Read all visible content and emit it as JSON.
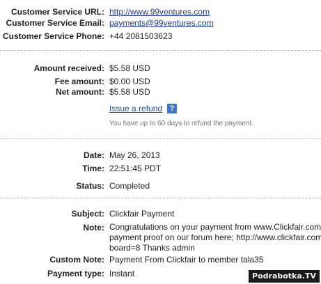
{
  "contact": {
    "url_label": "Customer Service URL:",
    "url_value": "http://www.99ventures.com",
    "email_label": "Customer Service Email:",
    "email_value": "payments@99ventures.com",
    "phone_label": "Customer Service Phone:",
    "phone_value": "+44 2081503623"
  },
  "amounts": {
    "received_label": "Amount received:",
    "received_value": "$5.58 USD",
    "fee_label": "Fee amount:",
    "fee_value": "$0.00 USD",
    "net_label": "Net amount:",
    "net_value": "$5.58 USD",
    "refund_link": "Issue a refund",
    "help_icon_glyph": "?",
    "refund_note": "You have up to 60 days to refund the payment."
  },
  "details": {
    "date_label": "Date:",
    "date_value": "May 26, 2013",
    "time_label": "Time:",
    "time_value": "22:51:45 PDT",
    "status_label": "Status:",
    "status_value": "Completed"
  },
  "message": {
    "subject_label": "Subject:",
    "subject_value": "Clickfair Payment",
    "note_label": "Note:",
    "note_lines": [
      "Congratulations on your payment from www.Clickfair.com",
      "payment proof on our forum here; http://www.clickfair.com",
      "board=8 Thanks admin"
    ],
    "custom_note_label": "Custom Note:",
    "custom_note_value": "Payment From Clickfair to member tala35",
    "payment_type_label": "Payment type:",
    "payment_type_value": "Instant"
  },
  "watermark": "Podrabotka.TV",
  "colors": {
    "link": "#1a3d8f",
    "help_icon_bg": "#3a77c4",
    "divider": "#b8b8b8",
    "watermark_bg": "#1a1a1a"
  }
}
